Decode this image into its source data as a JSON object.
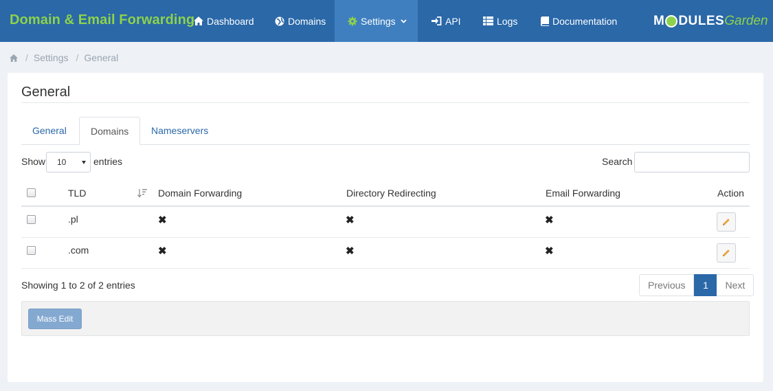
{
  "app": {
    "title": "Domain & Email Forwarding"
  },
  "nav": [
    {
      "label": "Dashboard",
      "icon": "home-icon"
    },
    {
      "label": "Domains",
      "icon": "globe-icon"
    },
    {
      "label": "Settings",
      "icon": "gear-icon",
      "active": true,
      "dropdown": true
    },
    {
      "label": "API",
      "icon": "sign-in-icon"
    },
    {
      "label": "Logs",
      "icon": "list-icon"
    },
    {
      "label": "Documentation",
      "icon": "book-icon"
    }
  ],
  "logo": {
    "part1": "M",
    "part2": "DULES",
    "part3": "Garden"
  },
  "breadcrumb": {
    "items": [
      "Settings",
      "General"
    ]
  },
  "page": {
    "title": "General"
  },
  "tabs": [
    {
      "label": "General",
      "active": false
    },
    {
      "label": "Domains",
      "active": true
    },
    {
      "label": "Nameservers",
      "active": false
    }
  ],
  "table_controls": {
    "show_label": "Show",
    "page_size": "10",
    "entries_label": "entries",
    "search_label": "Search",
    "search_value": ""
  },
  "table": {
    "columns": [
      "TLD",
      "Domain Forwarding",
      "Directory Redirecting",
      "Email Forwarding",
      "Action"
    ],
    "rows": [
      {
        "tld": ".pl",
        "domain_forwarding": "✖",
        "directory_redirecting": "✖",
        "email_forwarding": "✖"
      },
      {
        "tld": ".com",
        "domain_forwarding": "✖",
        "directory_redirecting": "✖",
        "email_forwarding": "✖"
      }
    ]
  },
  "pagination": {
    "info": "Showing 1 to 2 of 2 entries",
    "previous": "Previous",
    "current": "1",
    "next": "Next"
  },
  "actions": {
    "mass_edit": "Mass Edit"
  },
  "colors": {
    "topbar": "#2a68a8",
    "brand_green": "#8dd24c",
    "active_page": "#2a68a8",
    "edit_icon": "#e8a33d"
  }
}
